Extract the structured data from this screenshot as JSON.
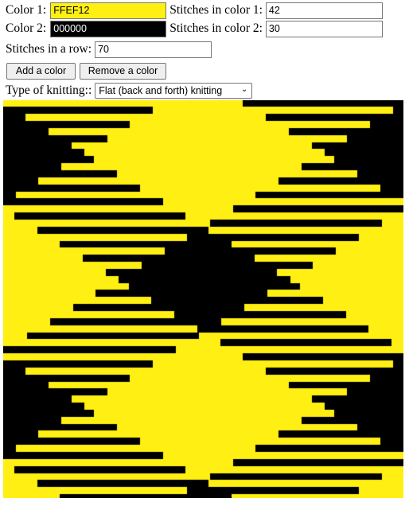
{
  "colors": [
    {
      "label": "Color 1:",
      "value": "FFEF12",
      "hex": "#FFEF12",
      "stitches_label": "Stitches in color 1:",
      "stitches": "42"
    },
    {
      "label": "Color 2:",
      "value": "000000",
      "hex": "#000000",
      "stitches_label": "Stitches in color 2:",
      "stitches": "30"
    }
  ],
  "row": {
    "label": "Stitches in a row:",
    "value": "70"
  },
  "buttons": {
    "add": "Add a color",
    "remove": "Remove a color"
  },
  "knitting": {
    "label": "Type of knitting::",
    "selected": "Flat (back and forth) knitting"
  },
  "pattern": {
    "rows": 70,
    "block1": 42,
    "block2": 30,
    "colors": [
      "#FFEF12",
      "#000000"
    ]
  }
}
